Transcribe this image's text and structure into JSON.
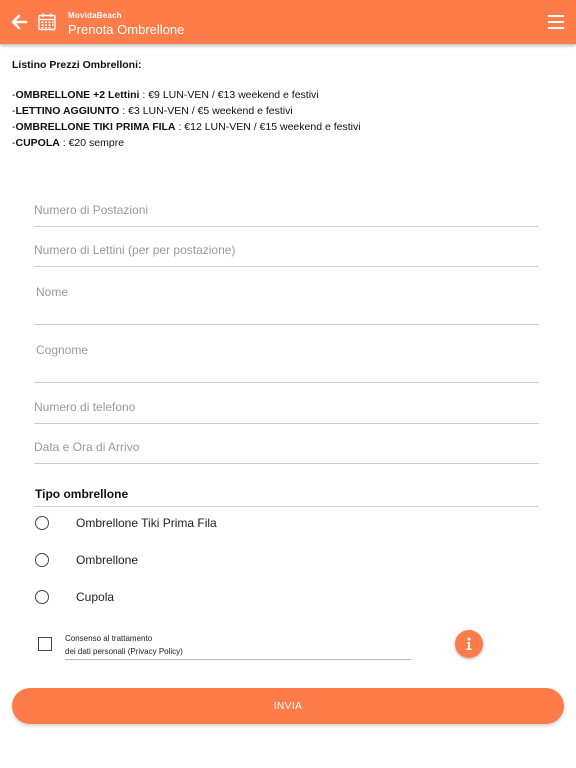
{
  "header": {
    "app_name": "MovidaBeach",
    "title": "Prenota Ombrellone",
    "back_icon": "arrow-left-icon",
    "calendar_icon": "calendar-icon",
    "menu_icon": "hamburger-menu-icon",
    "accent_color": "#fd7c4a"
  },
  "prices": {
    "title": "Listino Prezzi Ombrelloni:",
    "items": [
      {
        "name": "OMBRELLONE +2 Lettini",
        "detail": " : €9 LUN-VEN / €13 weekend e festivi"
      },
      {
        "name": "LETTINO AGGIUNTO",
        "detail": " : €3 LUN-VEN / €5 weekend e festivi"
      },
      {
        "name": "OMBRELLONE  TIKI PRIMA FILA",
        "detail": " : €12 LUN-VEN / €15 weekend e festivi"
      },
      {
        "name": "CUPOLA",
        "detail": " : €20 sempre"
      }
    ]
  },
  "form": {
    "fields": [
      {
        "placeholder": "Numero di Postazioni",
        "value": ""
      },
      {
        "placeholder": "Numero di Lettini (per per postazione)",
        "value": ""
      },
      {
        "placeholder": "Nome",
        "value": ""
      },
      {
        "placeholder": "Cognome",
        "value": ""
      },
      {
        "placeholder": "Numero di telefono",
        "value": ""
      },
      {
        "placeholder": "Data e Ora di Arrivo",
        "value": ""
      }
    ],
    "type_section_title": "Tipo ombrellone",
    "options": [
      {
        "label": "Ombrellone Tiki Prima Fila",
        "selected": false
      },
      {
        "label": "Ombrellone",
        "selected": false
      },
      {
        "label": "Cupola",
        "selected": false
      }
    ],
    "consent": {
      "line1": "Consenso al trattamento",
      "line2": "dei dati personali (Privacy Policy)",
      "checked": false
    },
    "info_icon": "info-icon",
    "submit_label": "INVIA"
  }
}
